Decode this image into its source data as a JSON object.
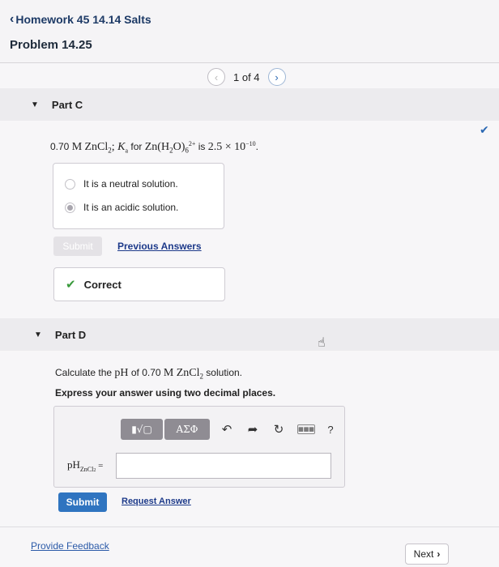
{
  "header": {
    "back_label": "Homework 45 14.14 Salts",
    "problem_title": "Problem 14.25"
  },
  "pager": {
    "text": "1 of 4"
  },
  "part_c": {
    "title": "Part C",
    "question_prefix": "0.70",
    "question_m": "M",
    "question_salt": "ZnCl",
    "question_salt_sub": "2",
    "question_sep": "; ",
    "question_k": "K",
    "question_k_sub": "a",
    "question_for": " for ",
    "question_complex": "Zn(H",
    "question_complex_sub1": "2",
    "question_complex_mid": "O)",
    "question_complex_sub2": "6",
    "question_complex_sup": "2+",
    "question_is": " is ",
    "question_value": "2.5 × 10",
    "question_exp": "−10",
    "question_end": ".",
    "options": [
      {
        "label": "It is a neutral solution.",
        "selected": false
      },
      {
        "label": "It is an acidic solution.",
        "selected": true
      }
    ],
    "submit_label": "Submit",
    "previous_answers_label": "Previous Answers",
    "feedback": "Correct"
  },
  "part_d": {
    "title": "Part D",
    "question_a": "Calculate the ",
    "question_ph": "pH",
    "question_b": " of 0.70 ",
    "question_m": "M",
    "question_salt": "ZnCl",
    "question_salt_sub": "2",
    "question_c": " solution.",
    "instruction": "Express your answer using two decimal places.",
    "toolbar": {
      "templates_label": "▮√▢",
      "greek_label": "ΑΣΦ",
      "undo_icon": "↶",
      "redo_icon": "➦",
      "reset_icon": "↻",
      "keyboard_icon": "▦▦▦",
      "help_label": "?"
    },
    "answer_label_main": "pH",
    "answer_label_sub": "ZnCl",
    "answer_label_sub2": "2",
    "answer_label_eq": " =",
    "answer_value": "",
    "submit_label": "Submit",
    "request_answer_label": "Request Answer"
  },
  "footer": {
    "feedback_label": "Provide Feedback",
    "next_label": "Next"
  },
  "colors": {
    "accent": "#2f74c0",
    "correct": "#3a9a3c",
    "link": "#1d3a8a"
  }
}
